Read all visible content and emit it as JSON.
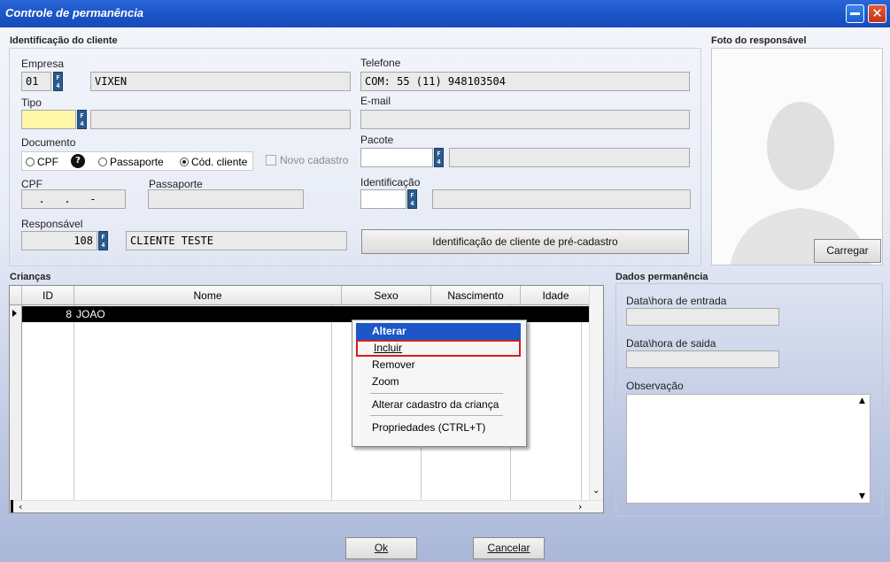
{
  "window": {
    "title": "Controle de permanência",
    "minimize_icon": "minimize-icon",
    "close_icon": "close-icon"
  },
  "cliente": {
    "section_label": "Identificação do cliente",
    "empresa": {
      "label": "Empresa",
      "code": "01",
      "name": "VIXEN"
    },
    "tipo": {
      "label": "Tipo",
      "code": "",
      "name": ""
    },
    "documento": {
      "label": "Documento",
      "options": [
        "CPF",
        "Passaporte",
        "Cód. cliente"
      ],
      "selected": "Cód. cliente",
      "novo_cadastro": "Novo cadastro"
    },
    "cpf": {
      "label": "CPF",
      "value": "  .   .   -"
    },
    "passaporte": {
      "label": "Passaporte",
      "value": ""
    },
    "responsavel": {
      "label": "Responsável",
      "code": "108",
      "name": "CLIENTE TESTE"
    },
    "telefone": {
      "label": "Telefone",
      "value": "COM: 55 (11) 948103504"
    },
    "email": {
      "label": "E-mail",
      "value": ""
    },
    "pacote": {
      "label": "Pacote",
      "code": "",
      "name": ""
    },
    "identificacao": {
      "label": "Identificação",
      "code": "",
      "name": ""
    },
    "pre_cadastro_button": "Identificação de cliente de pré-cadastro",
    "f4_key": "F4"
  },
  "foto": {
    "section_label": "Foto do responsável",
    "carregar_button": "Carregar"
  },
  "criancas": {
    "section_label": "Crianças",
    "columns": [
      "ID",
      "Nome",
      "Sexo",
      "Nascimento",
      "Idade"
    ],
    "rows": [
      {
        "id": "8",
        "nome": "JOAO",
        "sexo": "",
        "nascimento": "",
        "idade": ""
      }
    ]
  },
  "context_menu": {
    "items": [
      "Alterar",
      "Incluir",
      "Remover",
      "Zoom",
      "Alterar cadastro da criança",
      "Propriedades (CTRL+T)"
    ],
    "selected": "Alterar",
    "highlighted": "Incluir"
  },
  "permanencia": {
    "section_label": "Dados permanência",
    "entrada_label": "Data\\hora de entrada",
    "saida_label": "Data\\hora de saida",
    "observacao_label": "Observação"
  },
  "footer": {
    "ok_button": "Ok",
    "cancelar_button": "Cancelar"
  }
}
